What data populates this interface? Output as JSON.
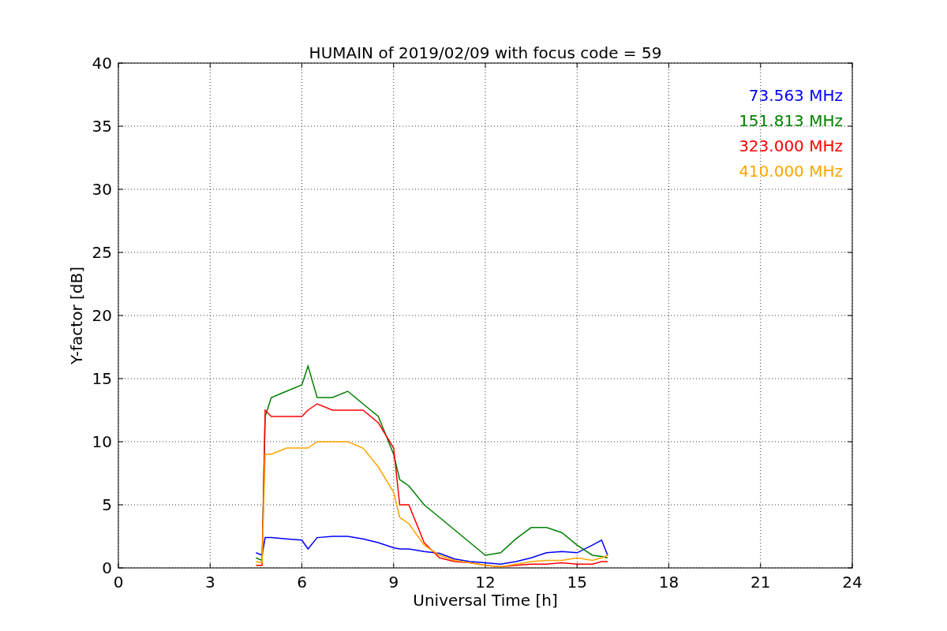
{
  "chart_data": {
    "type": "line",
    "title": "HUMAIN of 2019/02/09 with focus code = 59",
    "xlabel": "Universal Time [h]",
    "ylabel": "Y-factor [dB]",
    "x": [
      4.5,
      4.7,
      4.8,
      5,
      5.5,
      6,
      6.2,
      6.5,
      7,
      7.5,
      8,
      8.5,
      9,
      9.2,
      9.5,
      10,
      10.5,
      11,
      11.5,
      12,
      12.5,
      13,
      13.5,
      14,
      14.5,
      15,
      15.5,
      15.8,
      16
    ],
    "series": [
      {
        "name": "73.563 MHz",
        "color": "#0000ff",
        "values": [
          1.2,
          1.0,
          2.4,
          2.4,
          2.3,
          2.2,
          1.5,
          2.4,
          2.5,
          2.5,
          2.3,
          2.0,
          1.6,
          1.5,
          1.5,
          1.3,
          1.15,
          0.7,
          0.5,
          0.4,
          0.3,
          0.5,
          0.8,
          1.2,
          1.3,
          1.2,
          1.8,
          2.2,
          1.0
        ]
      },
      {
        "name": "151.813 MHz",
        "color": "#008000",
        "values": [
          0.8,
          0.6,
          12,
          13.5,
          14,
          14.5,
          16,
          13.5,
          13.5,
          14,
          13,
          12,
          9,
          7,
          6.5,
          5,
          4,
          3,
          2,
          1,
          1.2,
          2.3,
          3.2,
          3.2,
          2.8,
          1.8,
          1.0,
          0.9,
          0.8
        ]
      },
      {
        "name": "323.000 MHz",
        "color": "#ff0000",
        "values": [
          0.2,
          0.2,
          12.5,
          12,
          12,
          12,
          12.5,
          13,
          12.5,
          12.5,
          12.5,
          11.5,
          9.5,
          5,
          5,
          2,
          0.8,
          0.5,
          0.4,
          0.2,
          0.1,
          0.2,
          0.3,
          0.3,
          0.4,
          0.3,
          0.3,
          0.5,
          0.5
        ]
      },
      {
        "name": "410.000 MHz",
        "color": "#ffa500",
        "values": [
          0.5,
          0.4,
          9,
          9,
          9.5,
          9.5,
          9.5,
          10,
          10,
          10,
          9.5,
          8,
          6,
          4,
          3.5,
          1.8,
          1.0,
          0.6,
          0.4,
          0.2,
          0.1,
          0.3,
          0.5,
          0.6,
          0.6,
          0.8,
          0.6,
          0.8,
          1.0
        ]
      }
    ],
    "grid": true,
    "xlim": [
      0,
      24
    ],
    "ylim": [
      0,
      40
    ],
    "xticks": [
      0,
      3,
      6,
      9,
      12,
      15,
      18,
      21,
      24
    ],
    "yticks": [
      0,
      5,
      10,
      15,
      20,
      25,
      30,
      35,
      40
    ]
  }
}
